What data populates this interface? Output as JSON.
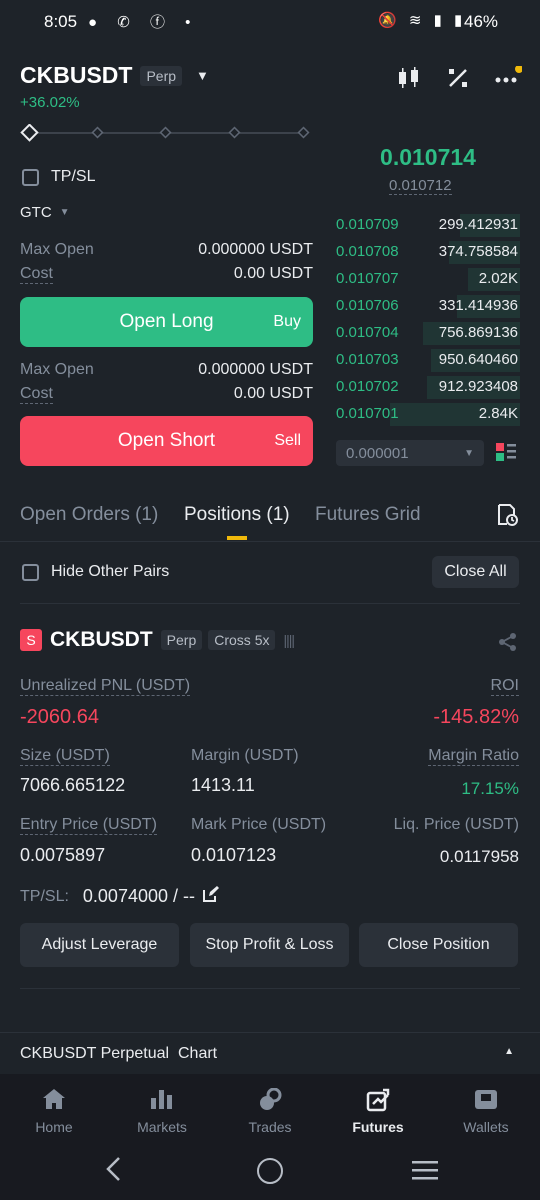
{
  "status_bar": {
    "time": "8:05",
    "battery": "46%"
  },
  "header": {
    "symbol": "CKBUSDT",
    "type_tag": "Perp",
    "change": "+36.02%"
  },
  "order_form": {
    "tpsl_label": "TP/SL",
    "tif": "GTC",
    "long": {
      "max_open_label": "Max Open",
      "max_open_value": "0.000000 USDT",
      "cost_label": "Cost",
      "cost_value": "0.00 USDT",
      "button": "Open Long",
      "side": "Buy"
    },
    "short": {
      "max_open_label": "Max Open",
      "max_open_value": "0.000000 USDT",
      "cost_label": "Cost",
      "cost_value": "0.00 USDT",
      "button": "Open Short",
      "side": "Sell"
    }
  },
  "orderbook": {
    "last_price": "0.010714",
    "mark_price": "0.010712",
    "rows": [
      {
        "price": "0.010709",
        "qty": "299.412931",
        "depth": 0.32
      },
      {
        "price": "0.010708",
        "qty": "374.758584",
        "depth": 0.38
      },
      {
        "price": "0.010707",
        "qty": "2.02K",
        "depth": 0.28
      },
      {
        "price": "0.010706",
        "qty": "331.414936",
        "depth": 0.34
      },
      {
        "price": "0.010704",
        "qty": "756.869136",
        "depth": 0.52
      },
      {
        "price": "0.010703",
        "qty": "950.640460",
        "depth": 0.48
      },
      {
        "price": "0.010702",
        "qty": "912.923408",
        "depth": 0.5
      },
      {
        "price": "0.010701",
        "qty": "2.84K",
        "depth": 0.7
      }
    ],
    "precision": "0.000001"
  },
  "tabs": [
    {
      "label": "Open Orders (1)",
      "active": false
    },
    {
      "label": "Positions (1)",
      "active": true
    },
    {
      "label": "Futures Grid",
      "active": false
    }
  ],
  "filter": {
    "hide_label": "Hide Other Pairs",
    "close_all": "Close All"
  },
  "position": {
    "side_badge": "S",
    "symbol": "CKBUSDT",
    "type_tag": "Perp",
    "margin_tag": "Cross 5x",
    "pnl_label": "Unrealized PNL (USDT)",
    "pnl_value": "-2060.64",
    "roi_label": "ROI",
    "roi_value": "-145.82%",
    "size_label": "Size (USDT)",
    "size_value": "7066.665122",
    "margin_label": "Margin (USDT)",
    "margin_value": "1413.11",
    "ratio_label": "Margin Ratio",
    "ratio_value": "17.15%",
    "entry_label": "Entry Price (USDT)",
    "entry_value": "0.0075897",
    "mark_label": "Mark Price (USDT)",
    "mark_value": "0.0107123",
    "liq_label": "Liq. Price (USDT)",
    "liq_value": "0.0117958",
    "tpsl_label": "TP/SL:",
    "tpsl_value": "0.0074000 / --",
    "btn_adjust": "Adjust Leverage",
    "btn_stop": "Stop Profit & Loss",
    "btn_close": "Close Position"
  },
  "chart_bar": {
    "label": "CKBUSDT Perpetual  Chart"
  },
  "bottom_nav": [
    {
      "label": "Home",
      "icon": "home-icon",
      "active": false
    },
    {
      "label": "Markets",
      "icon": "markets-icon",
      "active": false
    },
    {
      "label": "Trades",
      "icon": "trades-icon",
      "active": false
    },
    {
      "label": "Futures",
      "icon": "futures-icon",
      "active": true
    },
    {
      "label": "Wallets",
      "icon": "wallets-icon",
      "active": false
    }
  ]
}
